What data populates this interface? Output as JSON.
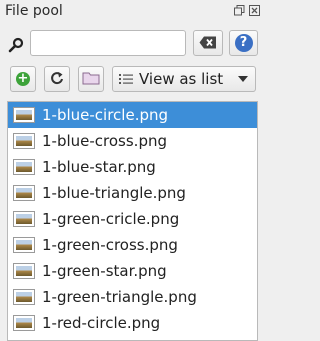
{
  "panel": {
    "title": "File pool"
  },
  "search": {
    "value": "",
    "placeholder": ""
  },
  "toolbar": {
    "view_mode": "View as list"
  },
  "files": [
    "1-blue-circle.png",
    "1-blue-cross.png",
    "1-blue-star.png",
    "1-blue-triangle.png",
    "1-green-cricle.png",
    "1-green-cross.png",
    "1-green-star.png",
    "1-green-triangle.png",
    "1-red-circle.png"
  ],
  "selected_index": 0,
  "colors": {
    "selection": "#3d8ed8",
    "help": "#3a6fc4",
    "add": "#3da33a",
    "background": "#efefef"
  },
  "icons": [
    "search-icon",
    "clear-icon",
    "help-icon",
    "add-icon",
    "refresh-icon",
    "folder-icon",
    "list-view-icon",
    "image-thumbnail-icon",
    "float-icon",
    "close-icon"
  ]
}
